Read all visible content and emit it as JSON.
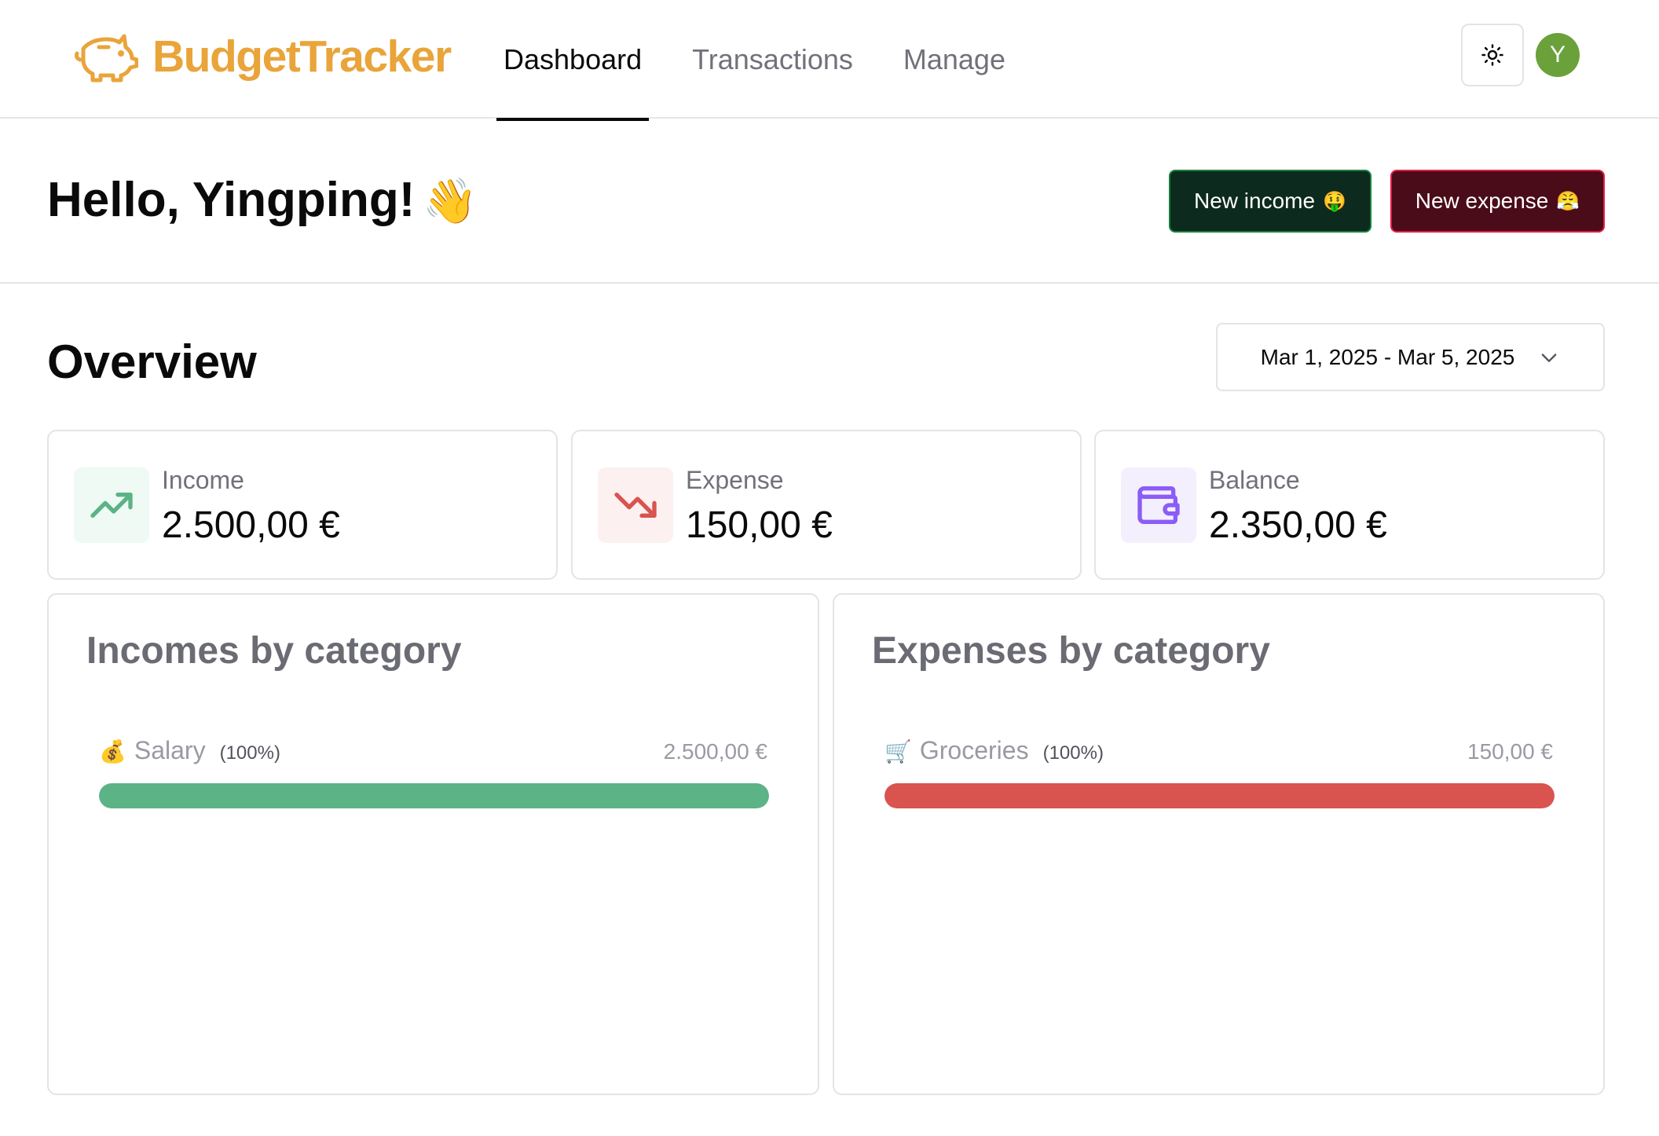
{
  "header": {
    "brand": "BudgetTracker",
    "brand_color": "#e9a43a",
    "logo_icon": "piggy-bank-icon",
    "nav": [
      {
        "label": "Dashboard",
        "active": true
      },
      {
        "label": "Transactions",
        "active": false
      },
      {
        "label": "Manage",
        "active": false
      }
    ],
    "theme_icon": "sun-icon",
    "avatar_initial": "Y",
    "avatar_color": "#6aa13a"
  },
  "greeting": {
    "text": "Hello, Yingping!",
    "emoji": "👋"
  },
  "actions": {
    "new_income_label": "New income",
    "new_income_emoji": "🤑",
    "new_expense_label": "New expense",
    "new_expense_emoji": "😤"
  },
  "overview": {
    "title": "Overview",
    "date_range": "Mar 1, 2025 - Mar 5, 2025"
  },
  "stats": {
    "income": {
      "label": "Income",
      "value": "2.500,00 €",
      "icon": "trending-up-icon",
      "color": "#5bb386"
    },
    "expense": {
      "label": "Expense",
      "value": "150,00 €",
      "icon": "trending-down-icon",
      "color": "#d9534f"
    },
    "balance": {
      "label": "Balance",
      "value": "2.350,00 €",
      "icon": "wallet-icon",
      "color": "#8b5cf6"
    }
  },
  "incomes_by_category": {
    "title": "Incomes by category",
    "items": [
      {
        "icon": "💰",
        "name": "Salary",
        "percent_label": "(100%)",
        "percent": 100,
        "amount": "2.500,00 €",
        "color": "#5bb386"
      }
    ]
  },
  "expenses_by_category": {
    "title": "Expenses by category",
    "items": [
      {
        "icon": "🛒",
        "name": "Groceries",
        "percent_label": "(100%)",
        "percent": 100,
        "amount": "150,00 €",
        "color": "#d9534f"
      }
    ]
  }
}
